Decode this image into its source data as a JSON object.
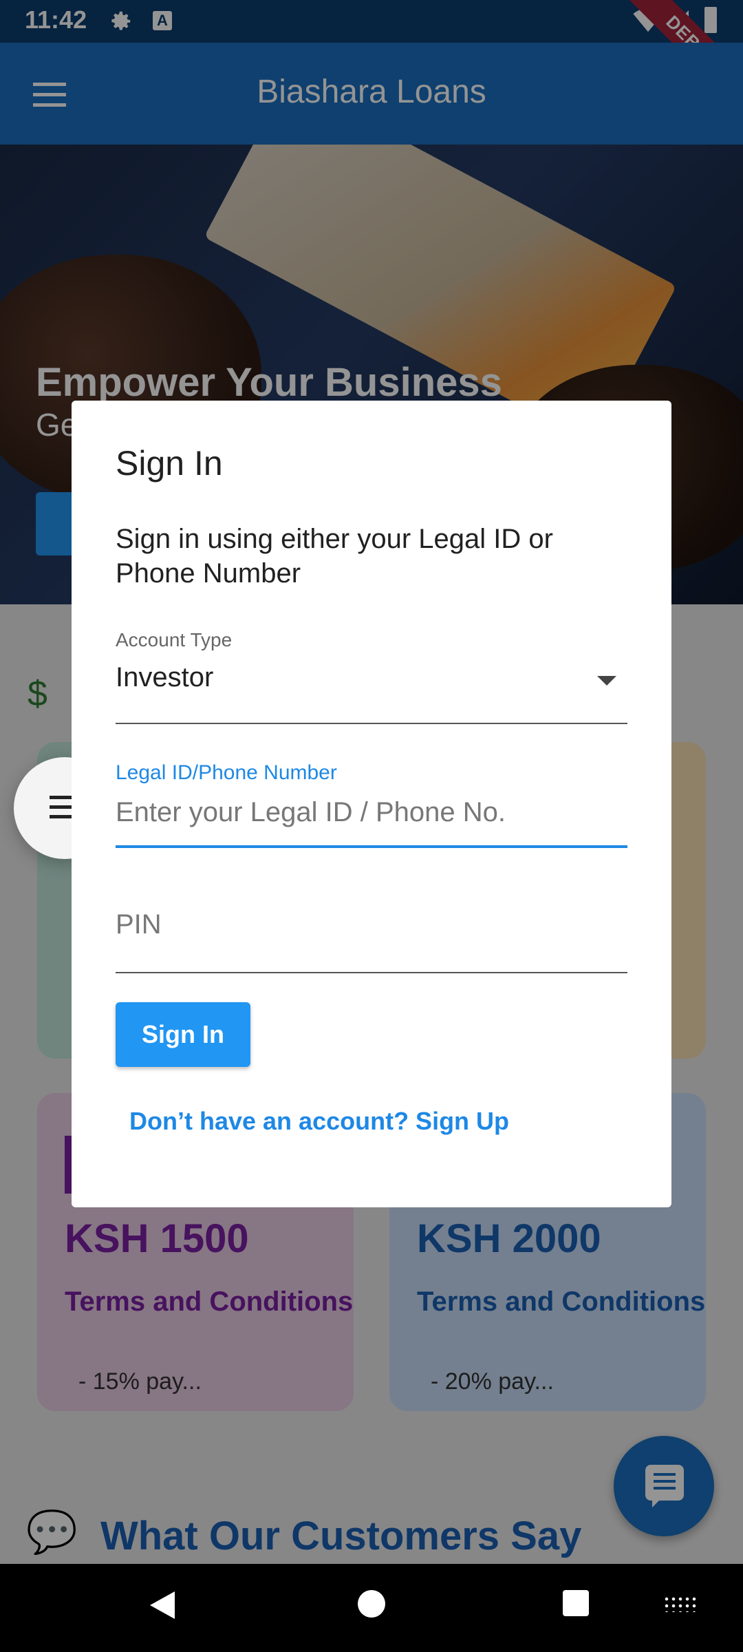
{
  "status_bar": {
    "time": "11:42",
    "debug_label": "DEBUG"
  },
  "app_bar": {
    "title": "Biashara Loans"
  },
  "hero": {
    "title": "Empower Your Business",
    "subtitle": "Ge"
  },
  "cards": [
    {
      "amount": "",
      "terms": "",
      "note": ""
    },
    {
      "amount": "",
      "terms": "",
      "note": ""
    },
    {
      "amount": "KSH 1500",
      "terms": "Terms and Conditions",
      "note": "- 15% pay..."
    },
    {
      "amount": "KSH 2000",
      "terms": "Terms and Conditions",
      "note": "- 20% pay..."
    }
  ],
  "testimonials": {
    "title": "What Our Customers Say"
  },
  "dialog": {
    "title": "Sign In",
    "description": "Sign in using either your Legal ID or Phone Number",
    "account_type": {
      "label": "Account Type",
      "value": "Investor"
    },
    "legal_id": {
      "label": "Legal ID/Phone Number",
      "placeholder": "Enter your Legal ID / Phone No."
    },
    "pin": {
      "placeholder": "PIN"
    },
    "submit_label": "Sign In",
    "signup_link": "Don’t have an account? Sign Up"
  },
  "icons": {
    "status": [
      "settings-icon",
      "notification-a-icon",
      "wifi-icon",
      "signal-icon",
      "battery-icon"
    ],
    "app_bar": "menu-icon",
    "fab": "chat-icon",
    "side_fab": "menu-icon"
  },
  "colors": {
    "primary": "#1a6fc0",
    "accent": "#2196f3",
    "link": "#1e88e5",
    "card_purple": "#7b1fa2"
  }
}
